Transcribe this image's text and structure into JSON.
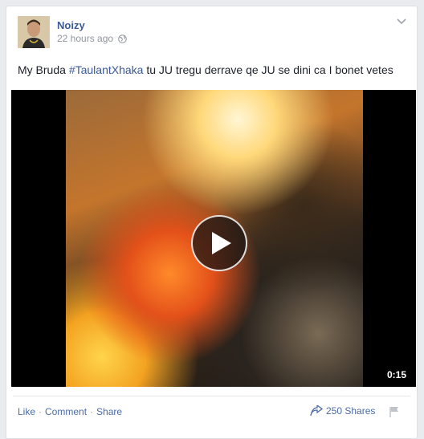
{
  "post": {
    "author": "Noizy",
    "timestamp": "22 hours ago",
    "privacy_icon": "globe-icon",
    "text_prefix": "My Bruda ",
    "hashtag": "#TaulantXhaka",
    "text_suffix": " tu JU tregu derrave qe JU se dini ca I bonet vetes"
  },
  "video": {
    "duration": "0:15"
  },
  "actions": {
    "like": "Like",
    "sep1": "·",
    "comment": "Comment",
    "sep2": "·",
    "share": "Share"
  },
  "shares": {
    "label": "250 Shares"
  },
  "colors": {
    "link": "#3b5998",
    "muted": "#90949c",
    "background": "#e9ebee"
  }
}
